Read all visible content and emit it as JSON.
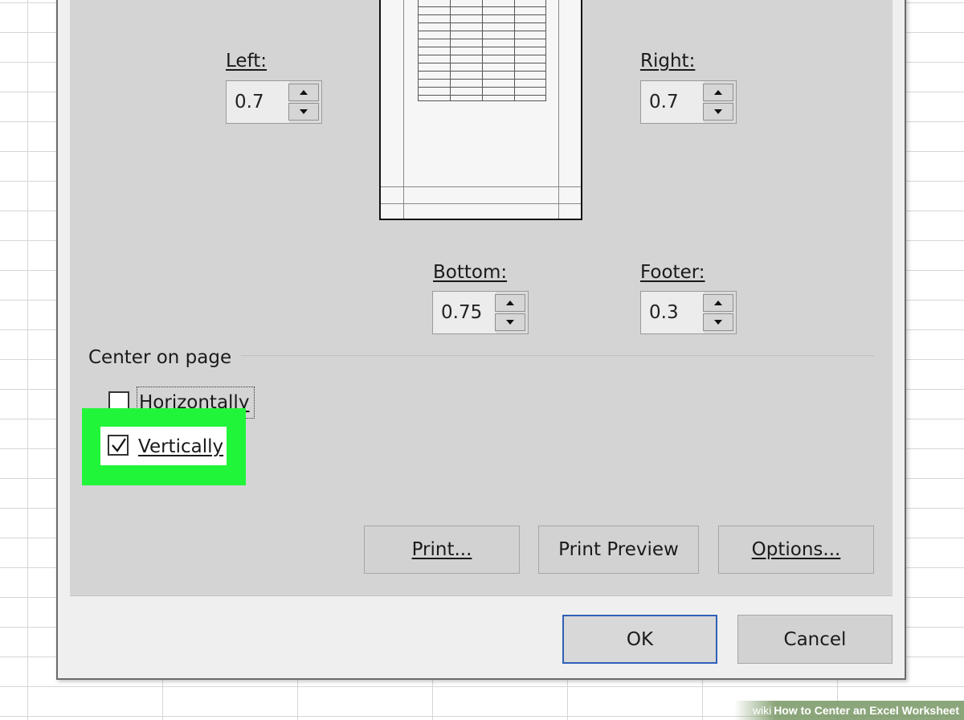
{
  "margins": {
    "left": {
      "label": "Left:",
      "value": "0.7"
    },
    "right": {
      "label": "Right:",
      "value": "0.7"
    },
    "bottom": {
      "label": "Bottom:",
      "value": "0.75"
    },
    "footer": {
      "label": "Footer:",
      "value": "0.3"
    }
  },
  "center_on_page": {
    "title": "Center on page",
    "horizontally": {
      "label": "Horizontally",
      "checked": false
    },
    "vertically": {
      "label": "Vertically",
      "checked": true
    }
  },
  "buttons": {
    "print": "Print...",
    "print_preview": "Print Preview",
    "options": "Options...",
    "ok": "OK",
    "cancel": "Cancel"
  },
  "watermark": {
    "prefix": "wiki",
    "text": "How to Center an Excel Worksheet"
  },
  "colors": {
    "highlight": "#21f53a",
    "ok_border": "#2f5fb8"
  }
}
